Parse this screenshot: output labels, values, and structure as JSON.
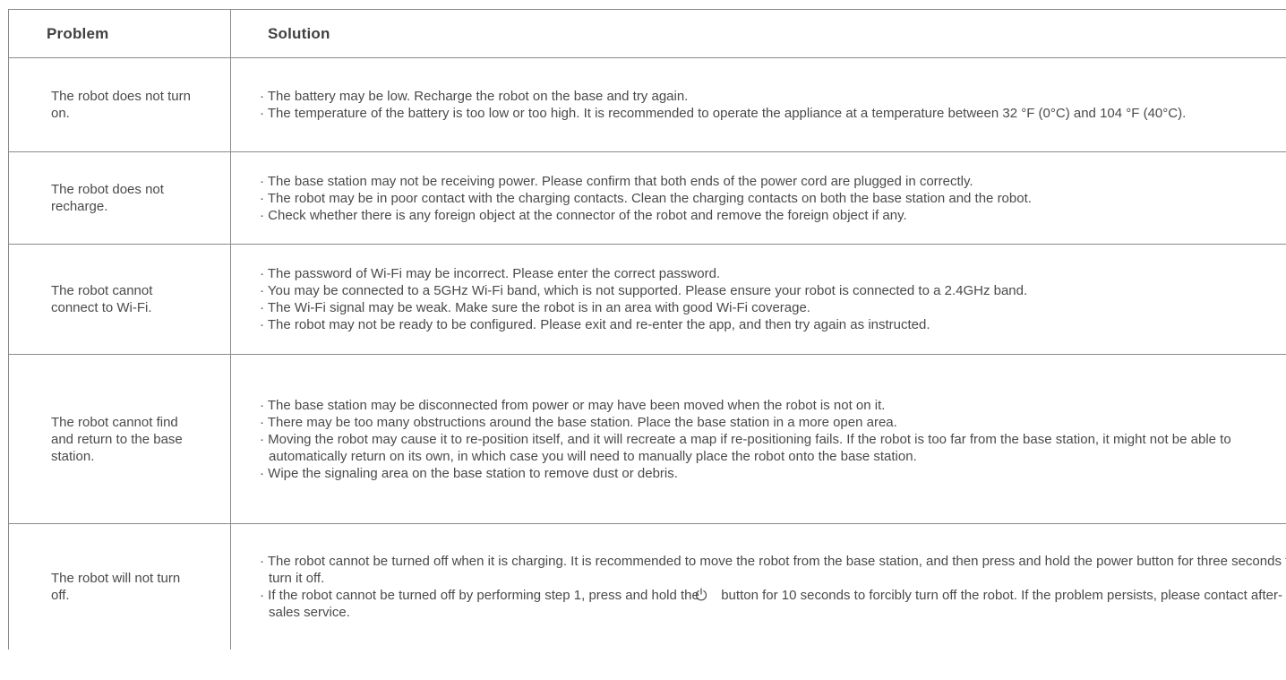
{
  "header": {
    "problem": "Problem",
    "solution": "Solution"
  },
  "rows": [
    {
      "problem": "The robot does not turn on.",
      "solutions": [
        "· The battery may be low. Recharge the robot on the base and try again.",
        "· The temperature of the battery is too low or too high. It is recommended to operate the appliance at a temperature between 32 °F (0°C) and 104 °F (40°C)."
      ]
    },
    {
      "problem": "The robot does not recharge.",
      "solutions": [
        "· The base station may not be receiving power. Please confirm that both ends of the power cord are plugged in correctly.",
        "· The robot may be in poor contact with the charging contacts. Clean the charging contacts on both the base station and the robot.",
        "· Check whether there is any foreign object at the connector of the robot and remove the foreign object if any."
      ]
    },
    {
      "problem": "The robot cannot connect to Wi-Fi.",
      "solutions": [
        "· The password of Wi-Fi may be incorrect. Please enter the correct password.",
        "· You may be connected to a 5GHz Wi-Fi band, which is not supported. Please ensure your robot is connected to a 2.4GHz band.",
        "· The Wi-Fi signal may be weak. Make sure the robot is in an area with good Wi-Fi coverage.",
        "· The robot may not be ready to be configured. Please exit and re-enter the app, and then try again as instructed."
      ]
    },
    {
      "problem": "The robot cannot find and return to the base station.",
      "solutions": [
        "· The base station may be disconnected from power or may have been moved when the robot is not on it.",
        "· There may be too many obstructions around the base station. Place the base station in a more open area.",
        "· Moving the robot may cause it to re-position itself, and it will recreate a map if re-positioning fails. If the robot is too far from the base station, it might not be able to automatically return on its own, in which case you will need to manually place the robot onto the base station.",
        "· Wipe the signaling area on the base station to remove dust or debris."
      ]
    },
    {
      "problem": "The robot will not turn off.",
      "solutions": [
        "· The robot cannot be turned off when it is charging. It is recommended to move the robot from the base station, and then press and hold the power button for three seconds to turn it off."
      ],
      "power_bullet": {
        "before": "· If the robot cannot be turned off by performing step 1, press and hold the",
        "icon": "power-icon",
        "after": "button for 10 seconds to forcibly turn off the robot. If the problem persists, please contact after-sales service."
      }
    }
  ]
}
